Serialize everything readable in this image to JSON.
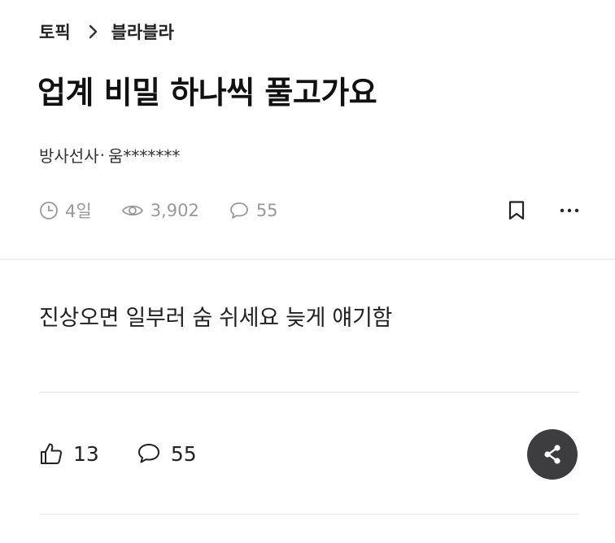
{
  "breadcrumb": {
    "category": "토픽",
    "subcategory": "블라블라"
  },
  "post": {
    "title": "업계 비밀 하나씩 풀고가요",
    "author_company": "방사선사",
    "author_separator": "·",
    "author_name": "움*******",
    "time_ago": "4일",
    "views": "3,902",
    "comments": "55",
    "body": "진상오면 일부러 숨 쉬세요 늦게 얘기함"
  },
  "reactions": {
    "likes": "13",
    "comments": "55"
  },
  "icons": {
    "chevron": "chevron-right-icon",
    "clock": "clock-icon",
    "eye": "eye-icon",
    "comment": "speech-bubble-icon",
    "bookmark": "bookmark-icon",
    "more": "more-horizontal-icon",
    "like": "thumbs-up-icon",
    "share": "share-icon"
  },
  "colors": {
    "text": "#222222",
    "muted": "#999999",
    "share_bg": "#3d3d40",
    "divider": "#eeeeee"
  }
}
